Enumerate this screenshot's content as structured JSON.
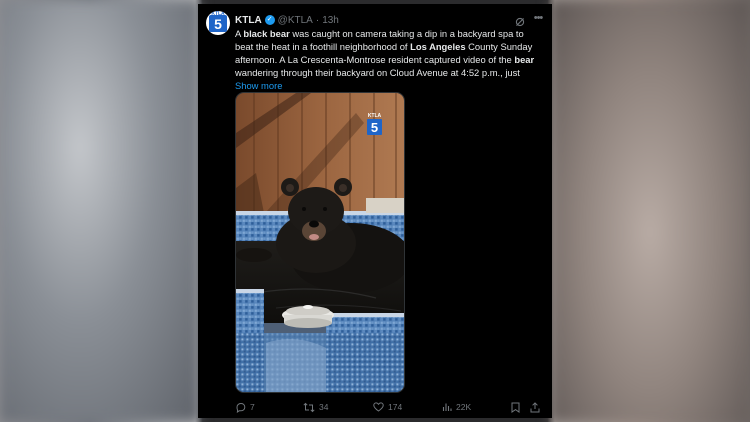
{
  "tweet": {
    "author_name": "KTLA",
    "handle": "@KTLA",
    "separator": "·",
    "time": "13h",
    "avatar_logo_top": "KTLA",
    "avatar_logo_num": "5",
    "text_parts": [
      {
        "t": "A ",
        "b": false
      },
      {
        "t": "black bear",
        "b": true
      },
      {
        "t": " was caught on camera taking a dip in a backyard spa to beat the heat in a foothill neighborhood of ",
        "b": false
      },
      {
        "t": "Los Angeles",
        "b": true
      },
      {
        "t": " County Sunday afternoon. A La Crescenta-Montrose resident captured video of the ",
        "b": false
      },
      {
        "t": "bear",
        "b": true
      },
      {
        "t": " wandering through their backyard on Cloud Avenue at 4:52 p.m., just",
        "b": false
      }
    ],
    "show_more": "Show more",
    "watermark": "5",
    "watermark_top": "KTLA",
    "stats": {
      "replies": "7",
      "reposts": "34",
      "likes": "174",
      "views": "22K"
    },
    "icons": {
      "verified": "verified-badge-icon",
      "grok": "grok-icon",
      "more": "more-icon",
      "reply": "reply-icon",
      "repost": "repost-icon",
      "like": "heart-icon",
      "views": "views-icon",
      "bookmark": "bookmark-icon",
      "share": "share-icon"
    },
    "colors": {
      "background": "#000000",
      "text": "#e7e9ea",
      "muted": "#71767b",
      "link": "#1d9bf0",
      "verified": "#1d9bf0"
    }
  }
}
